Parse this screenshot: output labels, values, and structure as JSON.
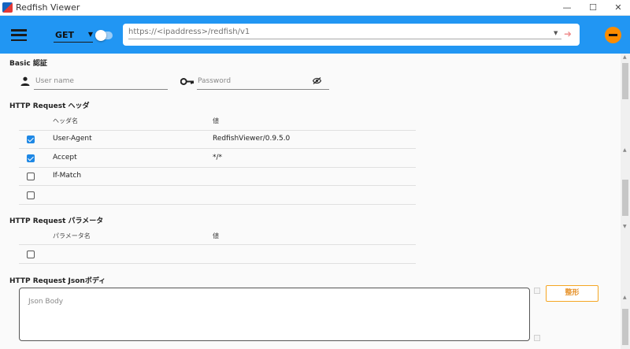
{
  "window": {
    "title": "Redfish Viewer",
    "buttons": {
      "minimize": "—",
      "maximize": "☐",
      "close": "✕"
    }
  },
  "appbar": {
    "method": "GET",
    "url_placeholder": "https://<ipaddress>/redfish/v1",
    "icons": {
      "menu": "hamburger-icon",
      "send": "send-icon",
      "remove": "minus-circle-icon"
    },
    "colors": {
      "bar": "#2196f3",
      "remove_button": "#fb8c00"
    }
  },
  "basic_auth": {
    "title": "Basic 認証",
    "username_placeholder": "User name",
    "password_placeholder": "Password"
  },
  "headers": {
    "title": "HTTP Request ヘッダ",
    "columns": [
      "ヘッダ名",
      "値"
    ],
    "rows": [
      {
        "checked": true,
        "name": "User-Agent",
        "value": "RedfishViewer/0.9.5.0"
      },
      {
        "checked": true,
        "name": "Accept",
        "value": "*/*"
      },
      {
        "checked": false,
        "name": "If-Match",
        "value": ""
      },
      {
        "checked": false,
        "name": "",
        "value": ""
      }
    ]
  },
  "params": {
    "title": "HTTP Request パラメータ",
    "columns": [
      "パラメータ名",
      "値"
    ],
    "rows": [
      {
        "checked": false,
        "name": "",
        "value": ""
      }
    ]
  },
  "json_body": {
    "title": "HTTP Request Jsonボディ",
    "placeholder": "Json Body",
    "format_button": "整形",
    "accent": "#f5a623"
  }
}
